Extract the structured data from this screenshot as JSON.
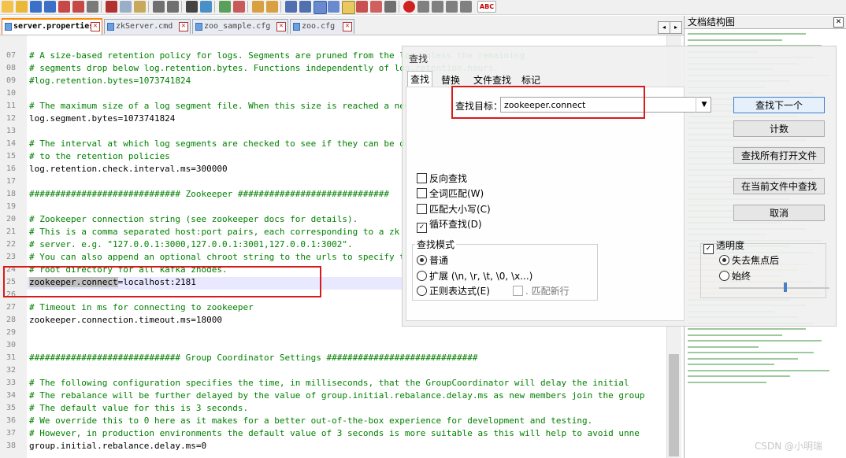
{
  "tabs": [
    {
      "label": "server.properties"
    },
    {
      "label": "zkServer.cmd"
    },
    {
      "label": "zoo_sample.cfg"
    },
    {
      "label": "zoo.cfg"
    }
  ],
  "nav": {
    "prev": "◂",
    "next": "▸"
  },
  "toolbar": {
    "spell": "ABC"
  },
  "editor_lines": [
    {
      "n": "07",
      "t": "# A size-based retention policy for logs. Segments are pruned from the log unless the remaining",
      "c": "cm"
    },
    {
      "n": "08",
      "t": "# segments drop below log.retention.bytes. Functions independently of log.retention.hours.",
      "c": "cm"
    },
    {
      "n": "09",
      "t": "#log.retention.bytes=1073741824",
      "c": "cm"
    },
    {
      "n": "10",
      "t": "",
      "c": "kv"
    },
    {
      "n": "11",
      "t": "# The maximum size of a log segment file. When this size is reached a new log segment will be created.",
      "c": "cm"
    },
    {
      "n": "12",
      "t": "log.segment.bytes=1073741824",
      "c": "kv"
    },
    {
      "n": "13",
      "t": "",
      "c": "kv"
    },
    {
      "n": "14",
      "t": "# The interval at which log segments are checked to see if they can be deleted according",
      "c": "cm"
    },
    {
      "n": "15",
      "t": "# to the retention policies",
      "c": "cm"
    },
    {
      "n": "16",
      "t": "log.retention.check.interval.ms=300000",
      "c": "kv"
    },
    {
      "n": "17",
      "t": "",
      "c": "kv"
    },
    {
      "n": "18",
      "t": "############################# Zookeeper #############################",
      "c": "cm"
    },
    {
      "n": "19",
      "t": "",
      "c": "kv"
    },
    {
      "n": "20",
      "t": "# Zookeeper connection string (see zookeeper docs for details).",
      "c": "cm"
    },
    {
      "n": "21",
      "t": "# This is a comma separated host:port pairs, each corresponding to a zk",
      "c": "cm"
    },
    {
      "n": "22",
      "t": "# server. e.g. \"127.0.0.1:3000,127.0.0.1:3001,127.0.0.1:3002\".",
      "c": "cm"
    },
    {
      "n": "23",
      "t": "# You can also append an optional chroot string to the urls to specify the",
      "c": "cm"
    },
    {
      "n": "24",
      "t": "# root directory for all kafka znodes.",
      "c": "cm"
    },
    {
      "n": "25",
      "t": "",
      "c": "kv"
    },
    {
      "n": "26",
      "t": "",
      "c": "kv"
    },
    {
      "n": "27",
      "t": "# Timeout in ms for connecting to zookeeper",
      "c": "cm"
    },
    {
      "n": "28",
      "t": "zookeeper.connection.timeout.ms=18000",
      "c": "kv"
    },
    {
      "n": "29",
      "t": "",
      "c": "kv"
    },
    {
      "n": "30",
      "t": "",
      "c": "kv"
    },
    {
      "n": "31",
      "t": "############################# Group Coordinator Settings #############################",
      "c": "cm"
    },
    {
      "n": "32",
      "t": "",
      "c": "kv"
    },
    {
      "n": "33",
      "t": "# The following configuration specifies the time, in milliseconds, that the GroupCoordinator will delay the initial",
      "c": "cm"
    },
    {
      "n": "34",
      "t": "# The rebalance will be further delayed by the value of group.initial.rebalance.delay.ms as new members join the group",
      "c": "cm"
    },
    {
      "n": "35",
      "t": "# The default value for this is 3 seconds.",
      "c": "cm"
    },
    {
      "n": "36",
      "t": "# We override this to 0 here as it makes for a better out-of-the-box experience for development and testing.",
      "c": "cm"
    },
    {
      "n": "37",
      "t": "# However, in production environments the default value of 3 seconds is more suitable as this will help to avoid unne",
      "c": "cm"
    },
    {
      "n": "38",
      "t": "group.initial.rebalance.delay.ms=0",
      "c": "kv"
    }
  ],
  "current_line": {
    "selected": "zookeeper.connect",
    "rest": "=localhost:2181"
  },
  "docmap": {
    "title": "文档结构图",
    "close": "✕"
  },
  "dialog": {
    "title": "查找",
    "tabs": [
      "查找",
      "替换",
      "文件查找",
      "标记"
    ],
    "find_label": "查找目标：",
    "find_value": "zookeeper.connect",
    "combo_arrow": "▼",
    "buttons": [
      "查找下一个",
      "计数",
      "查找所有打开文件",
      "在当前文件中查找",
      "取消"
    ],
    "options": [
      {
        "label": "反向查找",
        "checked": false
      },
      {
        "label": "全词匹配(W)",
        "checked": false
      },
      {
        "label": "匹配大小写(C)",
        "checked": false
      },
      {
        "label": "循环查找(D)",
        "checked": true
      }
    ],
    "mode_title": "查找模式",
    "modes": [
      {
        "label": "普通",
        "checked": true
      },
      {
        "label": "扩展 (\\n, \\r, \\t, \\0, \\x...)",
        "checked": false
      },
      {
        "label": "正则表达式(E)",
        "checked": false
      }
    ],
    "match_newline": ". 匹配新行",
    "transparency_label": "透明度",
    "transparency_checked": true,
    "transparency_modes": [
      {
        "label": "失去焦点后",
        "checked": true
      },
      {
        "label": "始终",
        "checked": false
      }
    ],
    "check_mark": "✓"
  },
  "watermark": "CSDN @小明瑞"
}
